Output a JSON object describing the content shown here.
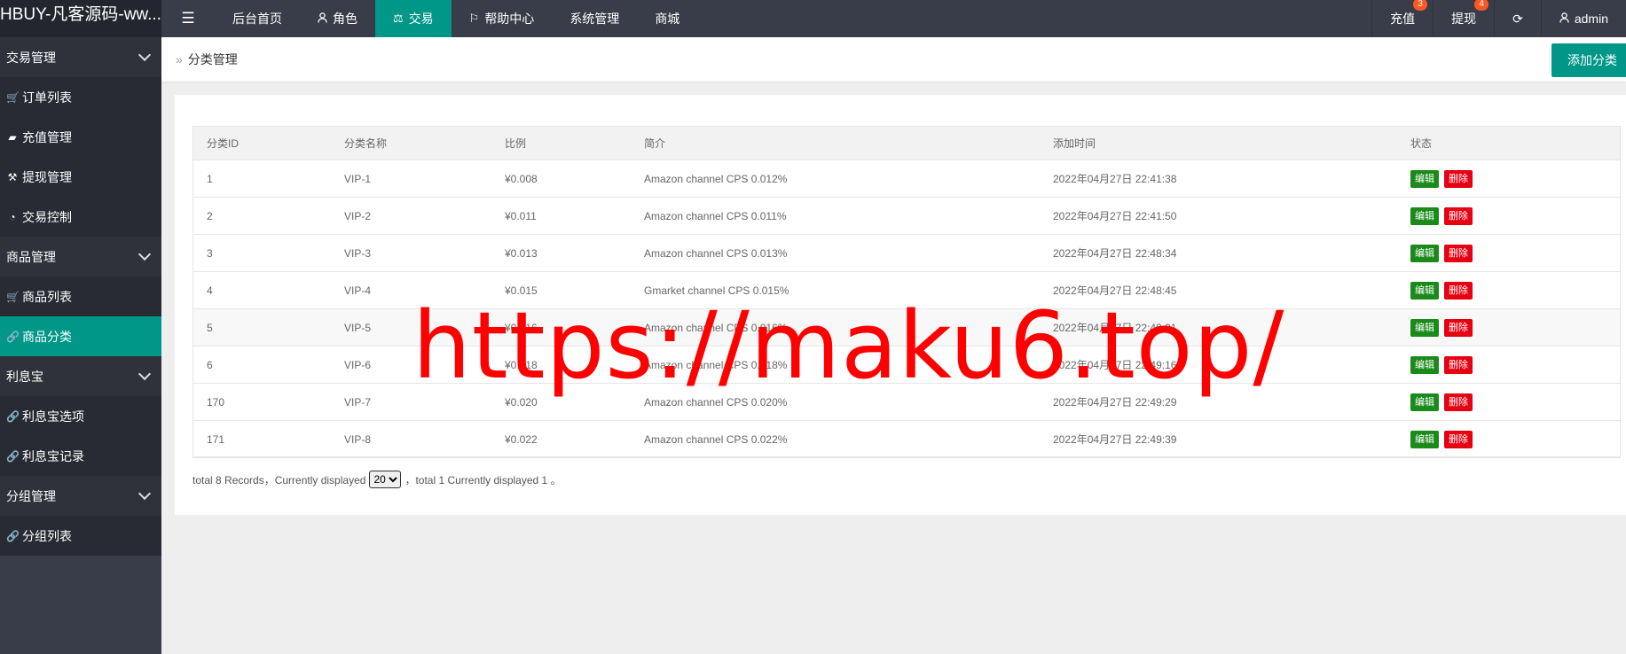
{
  "header": {
    "logo": "HBUY-凡客源码-ww...",
    "menu_icon": "hamburger-icon",
    "nav": [
      {
        "label": "后台首页",
        "icon": ""
      },
      {
        "label": "角色",
        "icon": "user-icon"
      },
      {
        "label": "交易",
        "icon": "scale-icon"
      },
      {
        "label": "帮助中心",
        "icon": "flag-icon"
      },
      {
        "label": "系统管理",
        "icon": ""
      },
      {
        "label": "商城",
        "icon": ""
      }
    ],
    "active_nav": "交易",
    "right": {
      "recharge": {
        "label": "充值",
        "badge": "3"
      },
      "withdraw": {
        "label": "提现",
        "badge": "4"
      },
      "refresh_icon": "refresh-icon",
      "user": "admin"
    }
  },
  "sidebar": {
    "groups": [
      {
        "title": "交易管理",
        "items": [
          {
            "label": "订单列表",
            "icon": "cart-icon"
          },
          {
            "label": "充值管理",
            "icon": "chat-icon"
          },
          {
            "label": "提现管理",
            "icon": "hammer-icon"
          },
          {
            "label": "交易控制",
            "icon": "dashboard-icon"
          }
        ]
      },
      {
        "title": "商品管理",
        "items": [
          {
            "label": "商品列表",
            "icon": "cart-icon"
          },
          {
            "label": "商品分类",
            "icon": "link-icon"
          }
        ]
      },
      {
        "title": "利息宝",
        "items": [
          {
            "label": "利息宝选项",
            "icon": "link-icon"
          },
          {
            "label": "利息宝记录",
            "icon": "link-icon"
          }
        ]
      },
      {
        "title": "分组管理",
        "items": [
          {
            "label": "分组列表",
            "icon": "link-icon"
          }
        ]
      }
    ],
    "active_item": "商品分类"
  },
  "breadcrumb": {
    "text": "分类管理"
  },
  "toolbar": {
    "add_label": "添加分类"
  },
  "table": {
    "columns": [
      "分类ID",
      "分类名称",
      "比例",
      "简介",
      "添加时间",
      "状态"
    ],
    "rows": [
      {
        "id": "1",
        "name": "VIP-1",
        "ratio": "¥0.008",
        "desc": "Amazon channel CPS 0.012%",
        "time": "2022年04月27日 22:41:38"
      },
      {
        "id": "2",
        "name": "VIP-2",
        "ratio": "¥0.011",
        "desc": "Amazon channel CPS 0.011%",
        "time": "2022年04月27日 22:41:50"
      },
      {
        "id": "3",
        "name": "VIP-3",
        "ratio": "¥0.013",
        "desc": "Amazon channel CPS 0.013%",
        "time": "2022年04月27日 22:48:34"
      },
      {
        "id": "4",
        "name": "VIP-4",
        "ratio": "¥0.015",
        "desc": "Gmarket channel CPS 0.015%",
        "time": "2022年04月27日 22:48:45"
      },
      {
        "id": "5",
        "name": "VIP-5",
        "ratio": "¥0.016",
        "desc": "Amazon channel CPS 0.016%",
        "time": "2022年04月27日 22:49:01"
      },
      {
        "id": "6",
        "name": "VIP-6",
        "ratio": "¥0.018",
        "desc": "Amazon channel CPS 0.018%",
        "time": "2022年04月27日 22:49:16"
      },
      {
        "id": "170",
        "name": "VIP-7",
        "ratio": "¥0.020",
        "desc": "Amazon channel CPS 0.020%",
        "time": "2022年04月27日 22:49:29"
      },
      {
        "id": "171",
        "name": "VIP-8",
        "ratio": "¥0.022",
        "desc": "Amazon channel CPS 0.022%",
        "time": "2022年04月27日 22:49:39"
      }
    ],
    "edit_label": "编辑",
    "delete_label": "删除"
  },
  "pager": {
    "prefix": "total 8 Records，Currently displayed",
    "page_size": "20",
    "suffix": "，total 1 Currently displayed 1 。"
  },
  "watermark": "https://maku6.top/",
  "colors": {
    "accent": "#009688",
    "header": "#393d49",
    "sidebar": "#282b33",
    "edit": "#1a8a1a",
    "delete": "#e60012",
    "badge": "#ff5722",
    "watermark": "#ff0000"
  }
}
